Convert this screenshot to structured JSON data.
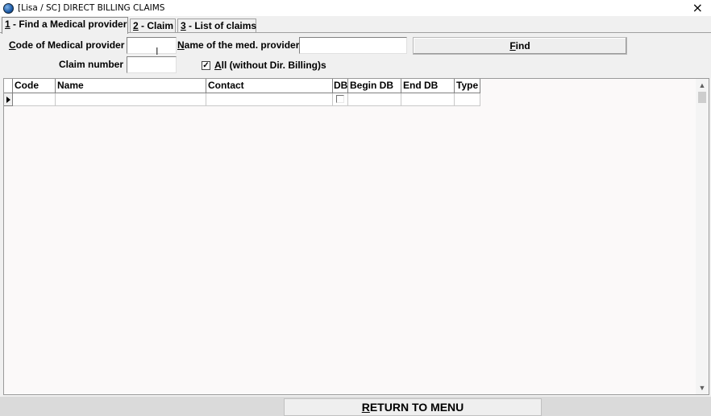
{
  "window": {
    "title": "[Lisa / SC] DIRECT BILLING CLAIMS",
    "close_label": "×"
  },
  "tabs": [
    {
      "key": "1",
      "label": " - Find a Medical provider",
      "active": true
    },
    {
      "key": "2",
      "label": " - Claim",
      "active": false
    },
    {
      "key": "3",
      "label": " - List of claims",
      "active": false
    }
  ],
  "search": {
    "code_label_key": "C",
    "code_label": "ode of Medical provider",
    "code_value": "",
    "name_label_key": "N",
    "name_label": "ame of the med. provider",
    "name_value": "",
    "find_key": "F",
    "find_label": "ind",
    "claim_label": "Claim number",
    "claim_value": "",
    "all_checked_mark": "✓",
    "all_label_key": "A",
    "all_label": "ll (without Dir. Billing)s"
  },
  "grid": {
    "columns": [
      "Code",
      "Name",
      "Contact",
      "DB",
      "Begin DB",
      "End DB",
      "Type"
    ],
    "rows": [
      {
        "Code": "",
        "Name": "",
        "Contact": "",
        "DB": false,
        "Begin DB": "",
        "End DB": "",
        "Type": ""
      }
    ],
    "scroll_up": "▲",
    "scroll_down": "▼"
  },
  "footer": {
    "return_key": "R",
    "return_label": "ETURN TO MENU"
  },
  "colors": {
    "window_bg": "#f0f0f0",
    "grid_bg": "#fbf9f9",
    "footer_bg": "#dadada"
  }
}
